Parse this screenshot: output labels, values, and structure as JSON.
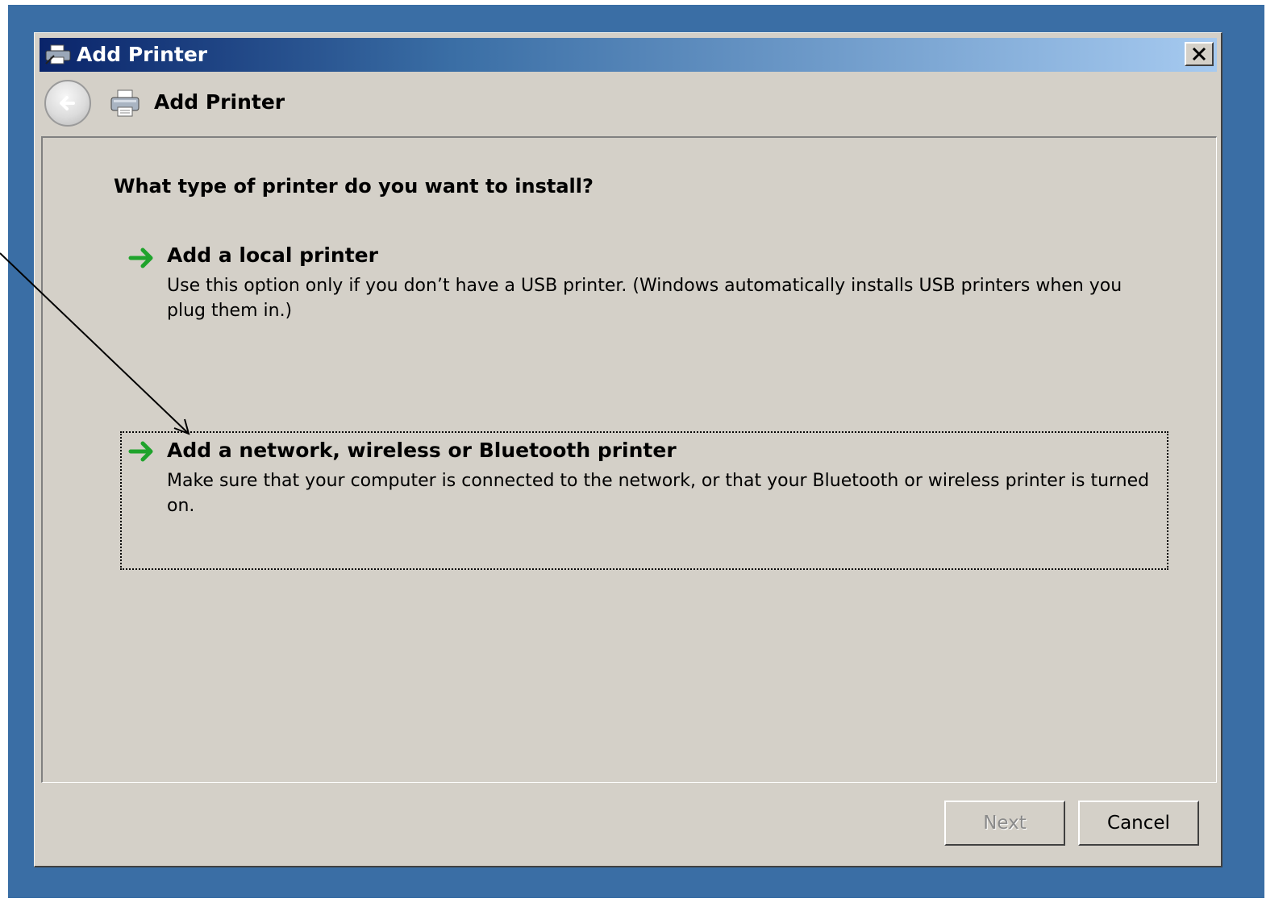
{
  "window": {
    "title": "Add Printer"
  },
  "nav": {
    "title": "Add Printer"
  },
  "content": {
    "question": "What type of printer do you want to install?",
    "options": [
      {
        "title": "Add a local printer",
        "description": "Use this option only if you don’t have a USB printer. (Windows automatically installs USB printers when you plug them in.)"
      },
      {
        "title": "Add a network, wireless or Bluetooth printer",
        "description": "Make sure that your computer is connected to the network, or that your Bluetooth or wireless printer is turned on."
      }
    ]
  },
  "buttons": {
    "next_label": "Next",
    "cancel_label": "Cancel",
    "next_enabled": false
  },
  "colors": {
    "desktop": "#3a6ea5",
    "window_face": "#d4d0c8",
    "titlebar_start": "#0a246a",
    "titlebar_end": "#a6caf0",
    "arrow_green": "#1fa32c"
  },
  "icons": {
    "title": "printer-icon",
    "back": "back-arrow-icon",
    "nav": "printer-icon",
    "option": "green-arrow-icon",
    "close": "close-icon"
  }
}
